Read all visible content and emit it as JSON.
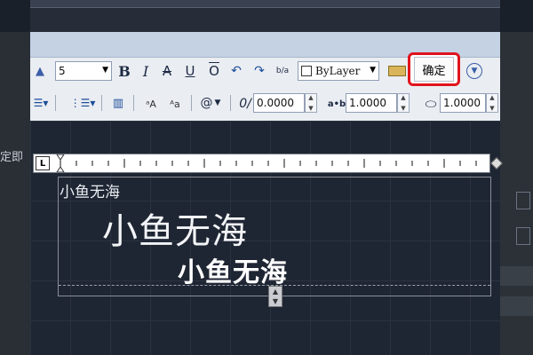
{
  "side": {
    "left_label": "定即"
  },
  "format": {
    "text_height": "5",
    "color_select": "ByLayer",
    "ok_label": "确定",
    "bold_glyph": "B",
    "italic_glyph": "I",
    "strike_glyph": "A",
    "underline_glyph": "U",
    "overline_glyph": "O",
    "stack_glyph": "b/a"
  },
  "params": {
    "oblique_value": "0.0000",
    "tracking_label": "a•b",
    "tracking_value": "1.0000",
    "width_value": "1.0000",
    "symbol_glyph": "@",
    "uppercase_glyph": "ᵃA",
    "lowercase_glyph": "ᴬa"
  },
  "ruler": {
    "tab_glyph": "L"
  },
  "content": {
    "line1": "小鱼无海",
    "line2": "小鱼无海",
    "line3": "小鱼无海"
  },
  "colors": {
    "highlight": "#e0141c",
    "canvas": "#1f2633",
    "toolbar": "#eaedf2"
  }
}
